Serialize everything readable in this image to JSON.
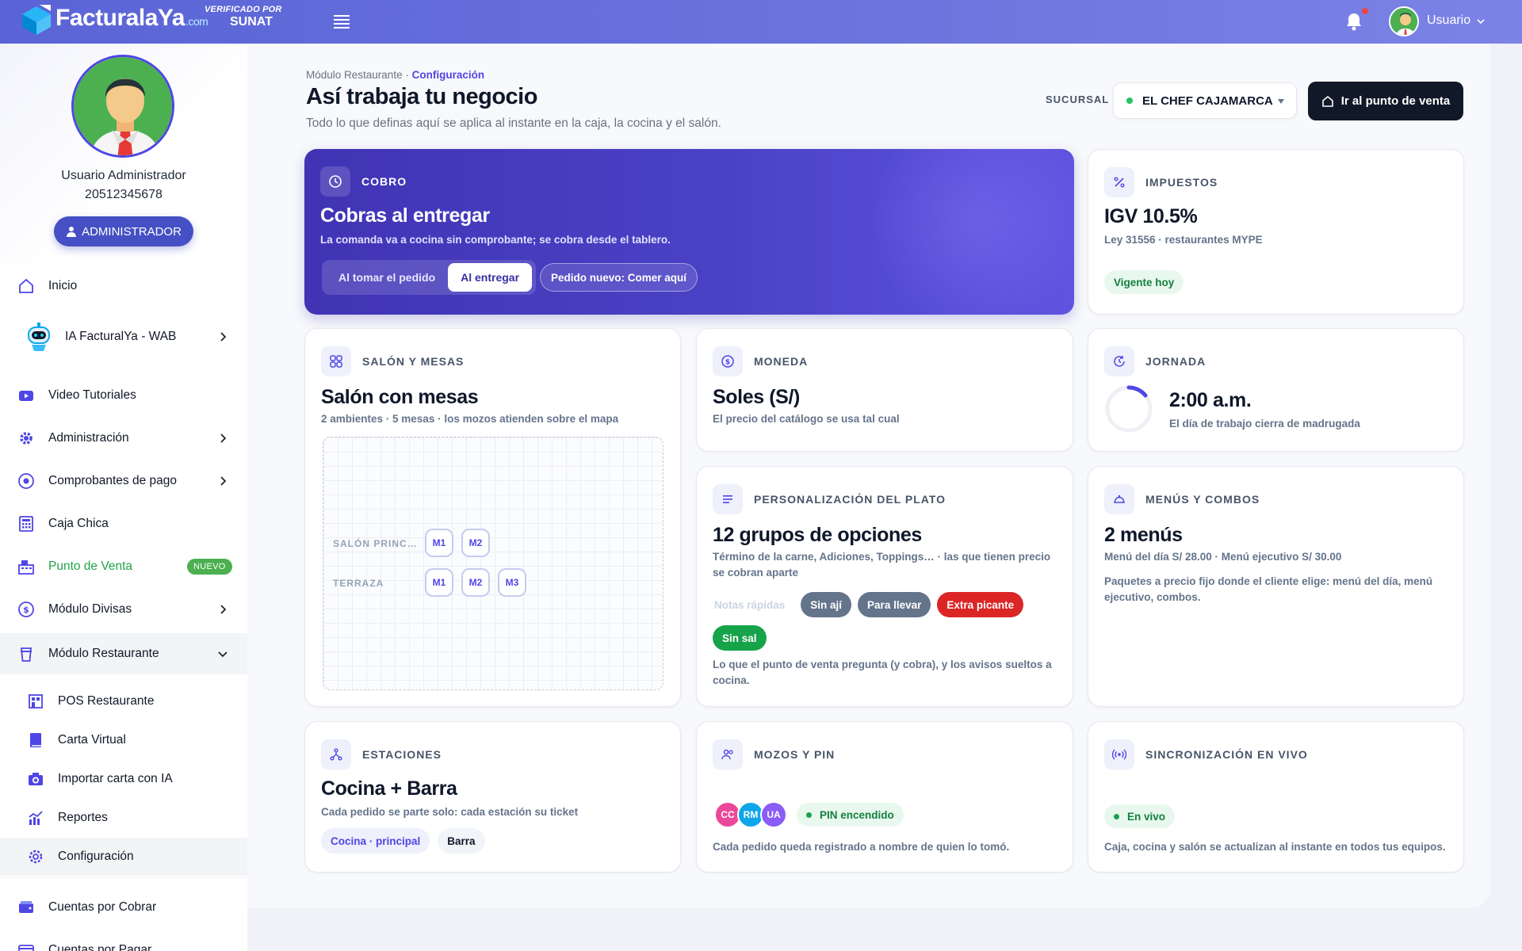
{
  "topbar": {
    "logo_text": "FacturalaYa",
    "logo_suffix": ".com",
    "verified_line1": "VERIFICADO POR",
    "verified_line2": "SUNAT",
    "user_label": "Usuario",
    "brand_color": "#5a64d6"
  },
  "sidebar": {
    "profile_name": "Usuario Administrador",
    "profile_ruc": "20512345678",
    "role_button": "ADMINISTRADOR",
    "items": [
      {
        "label": "Inicio",
        "icon": "home-icon"
      },
      {
        "label": "IA FacturalYa - WAB",
        "icon": "robot-icon"
      },
      {
        "label": "Video Tutoriales",
        "icon": "youtube-icon"
      },
      {
        "label": "Administración",
        "icon": "gear-icon"
      },
      {
        "label": "Comprobantes de pago",
        "icon": "eye-icon"
      },
      {
        "label": "Caja Chica",
        "icon": "calculator-icon"
      },
      {
        "label": "Punto de Venta",
        "icon": "register-icon",
        "badge": "NUEVO"
      },
      {
        "label": "Módulo Divisas",
        "icon": "currency-icon"
      },
      {
        "label": "Módulo Restaurante",
        "icon": "cup-icon"
      }
    ],
    "sub_items": [
      {
        "label": "POS Restaurante",
        "icon": "storefront-icon"
      },
      {
        "label": "Carta Virtual",
        "icon": "book-icon"
      },
      {
        "label": "Importar carta con IA",
        "icon": "camera-icon"
      },
      {
        "label": "Reportes",
        "icon": "chart-icon"
      },
      {
        "label": "Configuración",
        "icon": "gear-icon"
      }
    ],
    "after_items": [
      {
        "label": "Cuentas por Cobrar",
        "icon": "wallet-icon"
      },
      {
        "label": "Cuentas por Pagar",
        "icon": "card-icon"
      }
    ]
  },
  "header": {
    "breadcrumb_parent": "Módulo Restaurante",
    "breadcrumb_sep": "·",
    "breadcrumb_current": "Configuración",
    "title": "Así trabaja tu negocio",
    "subtitle": "Todo lo que defінas aquí se aplica al instante en la caja, la cocina y el salón.",
    "branch_label": "SUCURSAL",
    "branch_value": "EL CHEF CAJAMARCA",
    "pos_button": "Ir al punto de venta"
  },
  "cards": {
    "cobro": {
      "label": "COBRO",
      "title": "Cobras al entregar",
      "desc": "La comanda va a cocina sin comprobante; se cobra desde el tablero.",
      "options": [
        "Al tomar el pedido",
        "Al entregar"
      ],
      "selected": "Al entregar",
      "new_order_pill": "Pedido nuevo: Comer aquí"
    },
    "impuestos": {
      "label": "IMPUESTOS",
      "title": "IGV 10.5%",
      "desc": "Ley 31556 · restaurantes MYPE",
      "status": "Vigente hoy"
    },
    "salon": {
      "label": "SALÓN Y MESAS",
      "title": "Salón con mesas",
      "desc": "2 ambientes · 5 mesas · los mozos atienden sobre el mapa",
      "zones": [
        {
          "name": "SALÓN PRINCIPAL",
          "tables": [
            "M1",
            "M2"
          ]
        },
        {
          "name": "TERRAZA",
          "tables": [
            "M1",
            "M2",
            "M3"
          ]
        }
      ]
    },
    "moneda": {
      "label": "MONEDA",
      "title": "Soles (S/)",
      "desc": "El precio del catálogo se usa tal cual"
    },
    "jornada": {
      "label": "JORNADA",
      "title": "2:00 a.m.",
      "desc": "El día de trabajo cierra de madrugada"
    },
    "personalizacion": {
      "label": "PERSONALIZACIÓN DEL PLATO",
      "title": "12 grupos de opciones",
      "desc": "Término de la carne, Adiciones, Toppings… · las que tienen precio se cobran aparte",
      "chip_ghost": "Notas rápidas",
      "chips": [
        "Sin ají",
        "Para llevar",
        "Extra picante",
        "Sin sal"
      ],
      "footer": "Lo que el punto de venta pregunta (y cobra), y los avisos sueltos a cocina."
    },
    "menus": {
      "label": "MENÚS Y COMBOS",
      "title": "2 menús",
      "desc": "Menú del día S/ 28.00 · Menú ejecutivo S/ 30.00",
      "footer": "Paquetes a precio fijo donde el cliente elige: menú del día, menú ejecutivo, combos."
    },
    "estaciones": {
      "label": "ESTACIONES",
      "title": "Cocina + Barra",
      "desc": "Cada pedido se parte solo: cada estación su ticket",
      "chips": [
        "Cocina · principal",
        "Barra"
      ]
    },
    "mozos": {
      "label": "MOZOS Y PIN",
      "avatars": [
        "CC",
        "RM",
        "UA"
      ],
      "avatar_colors": [
        "#ec4899",
        "#0ea5e9",
        "#8b5cf6"
      ],
      "pin_status": "PIN encendido",
      "footer": "Cada pedido queda registrado a nombre de quien lo tomó."
    },
    "sync": {
      "label": "SINCRONIZACIÓN EN VIVO",
      "status": "En vivo",
      "footer": "Caja, cocina y salón se actualizan al instante en todos tus equipos."
    }
  }
}
